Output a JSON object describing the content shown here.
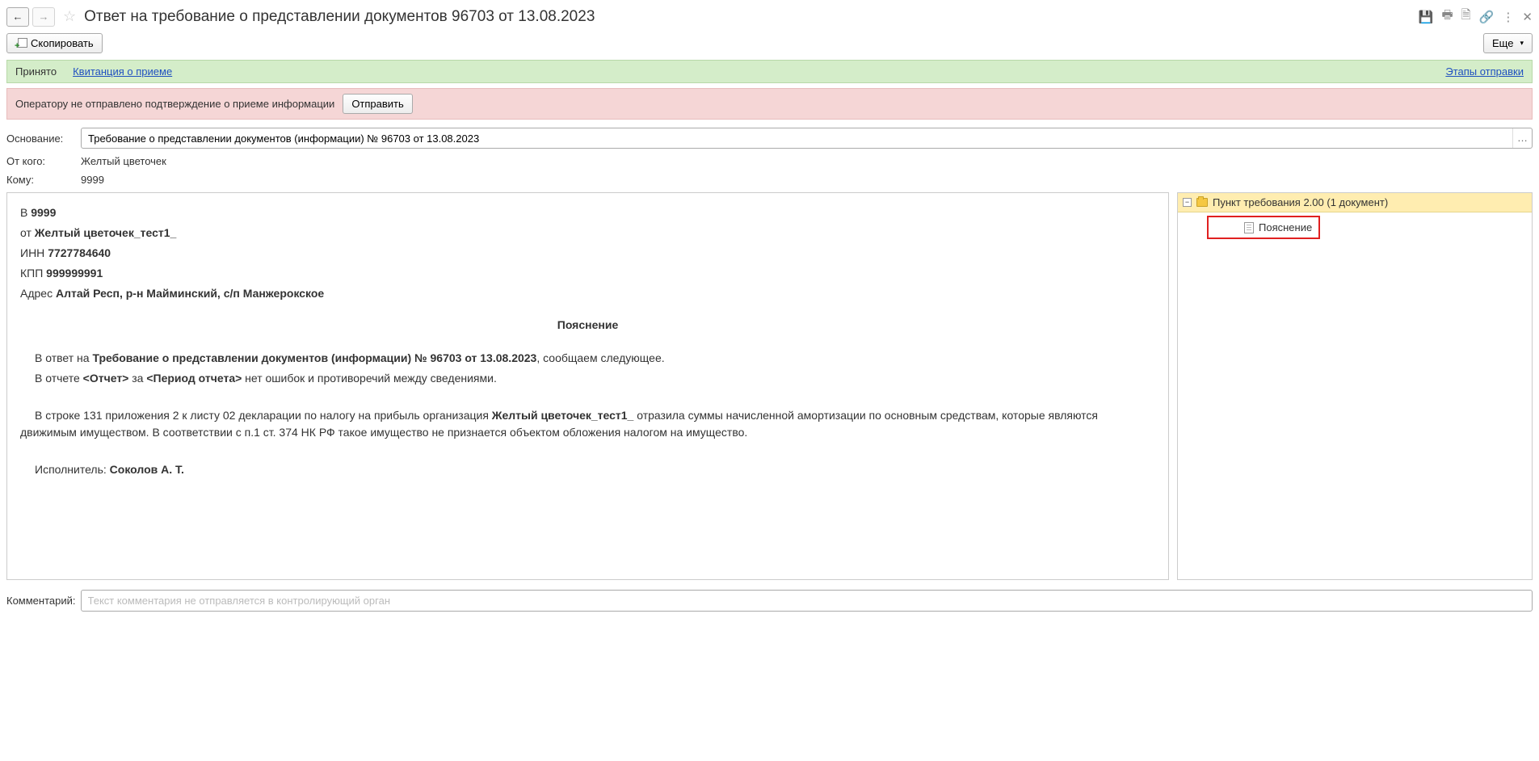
{
  "header": {
    "title": "Ответ на требование о представлении документов 96703 от 13.08.2023",
    "copy_label": "Скопировать",
    "more_label": "Еще"
  },
  "status": {
    "state": "Принято",
    "receipt_link": "Квитанция о приеме",
    "stages_link": "Этапы отправки"
  },
  "warning": {
    "text": "Оператору не отправлено подтверждение о приеме информации",
    "send_label": "Отправить"
  },
  "form": {
    "basis_label": "Основание:",
    "basis_value": "Требование о представлении документов (информации) № 96703 от 13.08.2023",
    "from_label": "От кого:",
    "from_value": "Желтый цветочек",
    "to_label": "Кому:",
    "to_value": "9999"
  },
  "document": {
    "to_prefix": "В ",
    "to_code": "9999",
    "from_prefix": "от ",
    "from_name": "Желтый цветочек_тест1_",
    "inn_label": "ИНН ",
    "inn_value": "7727784640",
    "kpp_label": "КПП ",
    "kpp_value": "999999991",
    "addr_label": "Адрес ",
    "addr_value": "Алтай Респ, р-н Майминский, с/п Манжерокское",
    "title": "Пояснение",
    "p1_a": "В ответ на ",
    "p1_b": "Требование о представлении документов (информации) № 96703 от 13.08.2023",
    "p1_c": ", сообщаем следующее.",
    "p2_a": "В отчете ",
    "p2_b": "<Отчет>",
    "p2_c": " за ",
    "p2_d": "<Период отчета>",
    "p2_e": " нет ошибок и противоречий между сведениями.",
    "p3_a": "В строке 131 приложения 2 к листу 02 декларации по налогу на прибыль организация ",
    "p3_b": "Желтый цветочек_тест1_",
    "p3_c": " отразила суммы начисленной амортизации по основным средствам, которые являются движимым имуществом. В соответствии с п.1 ст. 374 НК РФ такое имущество не признается объектом обложения налогом на имущество.",
    "executor_label": "Исполнитель: ",
    "executor_name": "Соколов А. Т."
  },
  "tree": {
    "folder_label": "Пункт требования 2.00 (1 документ)",
    "item_label": "Пояснение"
  },
  "comment": {
    "label": "Комментарий:",
    "placeholder": "Текст комментария не отправляется в контролирующий орган"
  }
}
